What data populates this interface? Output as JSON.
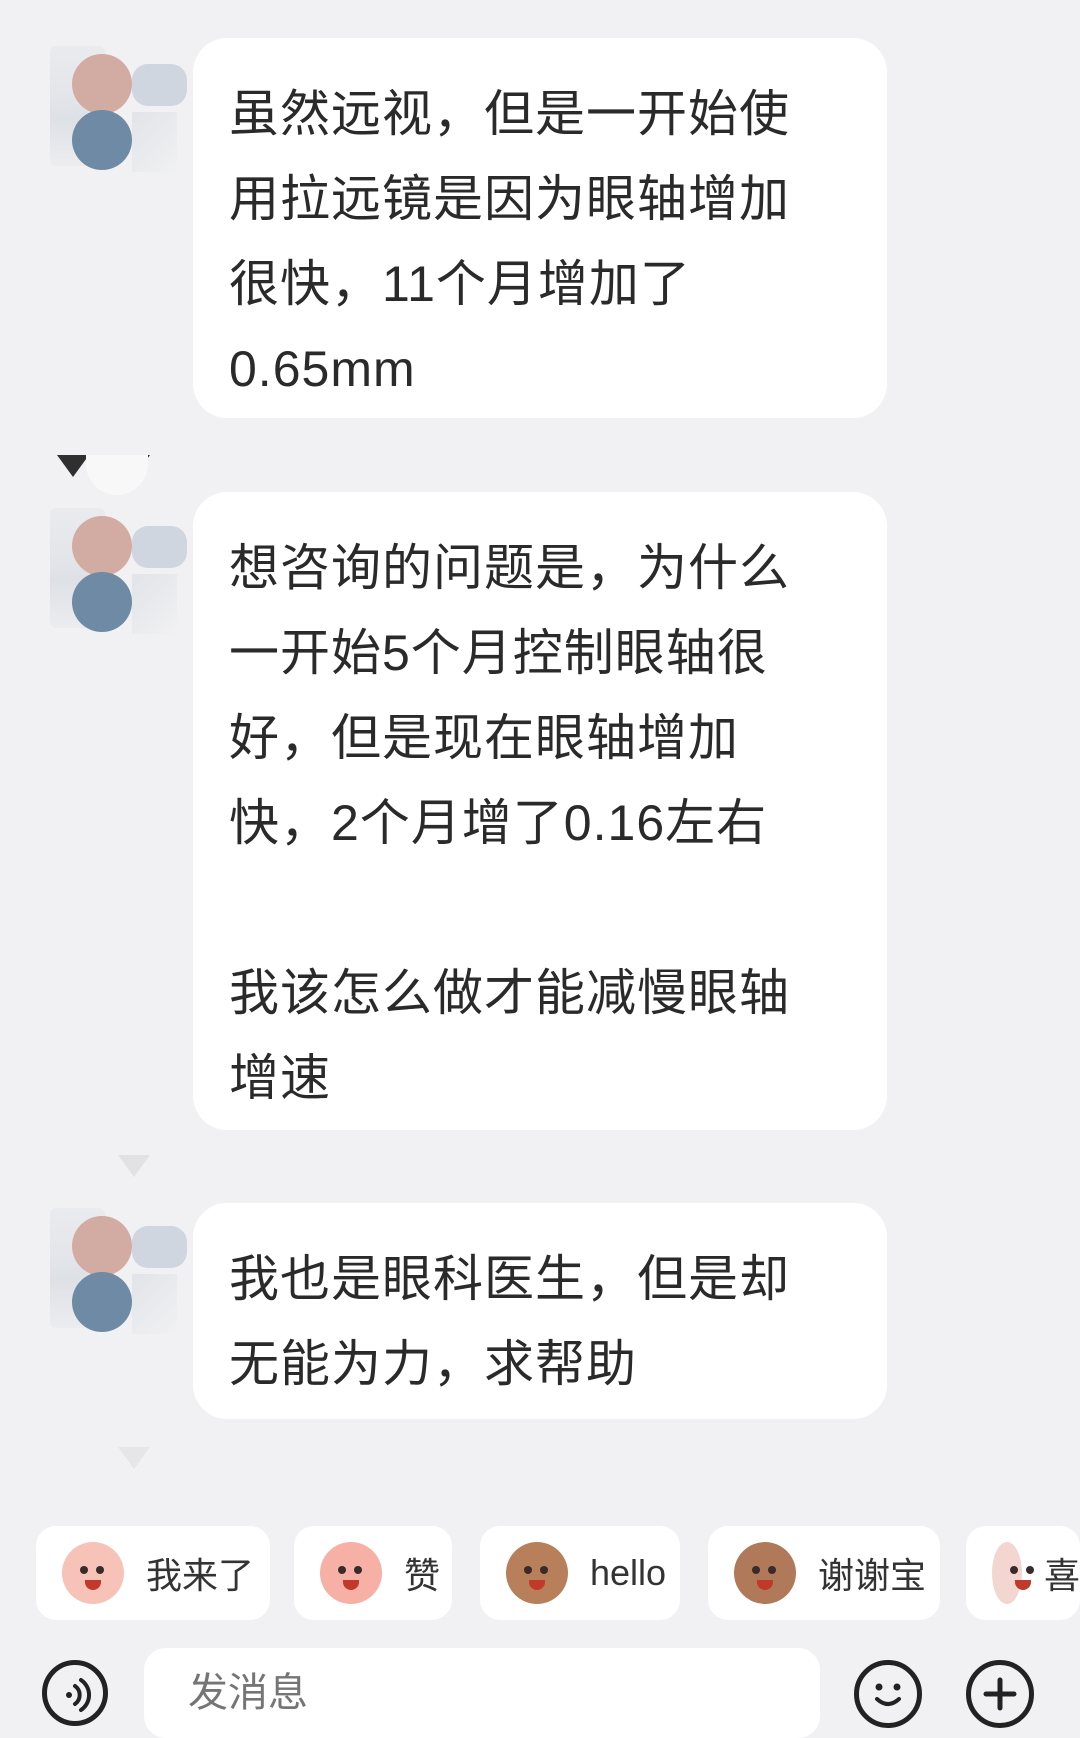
{
  "messages": [
    {
      "text": "虽然远视，但是一开始使\n用拉远镜是因为眼轴增加\n很快，11个月增加了\n0.65mm"
    },
    {
      "text": "想咨询的问题是，为什么\n一开始5个月控制眼轴很\n好，但是现在眼轴增加\n快，2个月增了0.16左右\n\n我该怎么做才能减慢眼轴\n增速"
    },
    {
      "text": "我也是眼科医生，但是却\n无能为力，求帮助"
    }
  ],
  "quick_replies": [
    {
      "label": "我来了",
      "icon": "pink-sticker-icon",
      "color": "#f7c2b8"
    },
    {
      "label": "赞",
      "icon": "pink-sticker-icon",
      "color": "#f6b0a5"
    },
    {
      "label": "hello",
      "icon": "monkey-sticker-icon",
      "color": "#b8805a"
    },
    {
      "label": "谢谢宝",
      "icon": "monkey-rose-sticker-icon",
      "color": "#b0795a"
    },
    {
      "label": "喜",
      "icon": "sheep-sticker-icon",
      "color": "#f3d6cf"
    }
  ],
  "input": {
    "placeholder": "发消息"
  },
  "icons": {
    "voice": "voice-icon",
    "emoji": "emoji-icon",
    "plus": "plus-icon"
  }
}
